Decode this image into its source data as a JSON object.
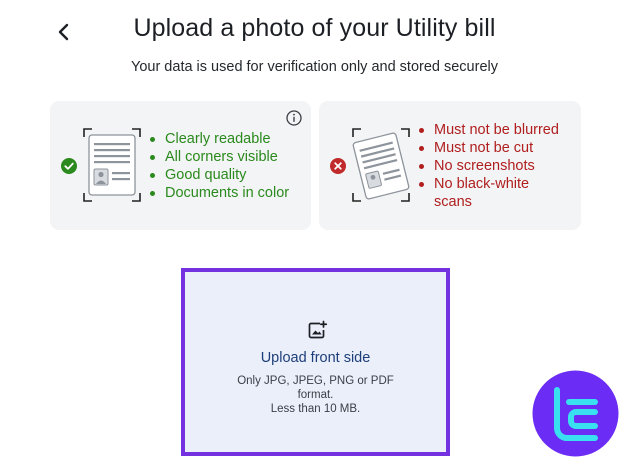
{
  "header": {
    "back_icon": "chevron-left-icon",
    "title": "Upload a photo of your Utility bill",
    "subtitle": "Your data is used for verification only and stored securely"
  },
  "requirements": {
    "good": {
      "status_icon": "check-circle-icon",
      "items": [
        "Clearly readable",
        "All corners visible",
        "Good quality",
        "Documents in color"
      ],
      "color": "#2a8a1d"
    },
    "bad": {
      "status_icon": "x-circle-icon",
      "items": [
        "Must not be blurred",
        "Must not be cut",
        "No screenshots",
        "No black-white scans"
      ],
      "color": "#b01e1e"
    },
    "info_icon": "info-icon"
  },
  "upload": {
    "icon": "add-image-icon",
    "title": "Upload front side",
    "note_line1": "Only JPG, JPEG, PNG or PDF format.",
    "note_line2": "Less than 10 MB.",
    "border_color": "#7331e0"
  },
  "watermark": {
    "icon": "tc-logo-icon",
    "color": "#6b2cf5"
  }
}
